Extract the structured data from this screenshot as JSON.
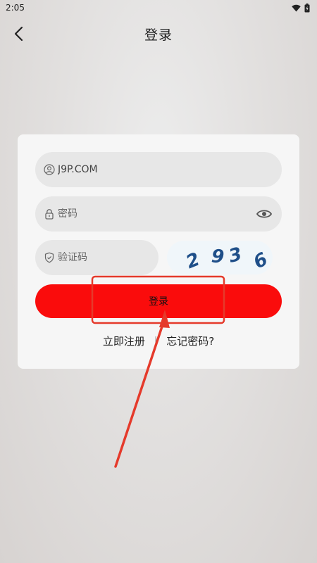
{
  "status_bar": {
    "time": "2:05"
  },
  "nav": {
    "title": "登录"
  },
  "form": {
    "account_value": "J9P.COM",
    "password_placeholder": "密码",
    "captcha_placeholder": "验证码",
    "captcha_chars": [
      "2",
      "9",
      "3",
      "6"
    ],
    "login_label": "登录",
    "register_link": "立即注册",
    "separator": "|",
    "forgot_link": "忘记密码?"
  },
  "icons": {
    "back": "back-arrow-icon",
    "user": "user-icon",
    "lock": "lock-icon",
    "eye": "eye-icon",
    "shield": "shield-check-icon",
    "wifi": "wifi-icon",
    "battery": "battery-icon"
  },
  "colors": {
    "primary_button": "#fa0c0c",
    "annotation": "#e53a2b",
    "captcha_text": "#1f4f89"
  }
}
